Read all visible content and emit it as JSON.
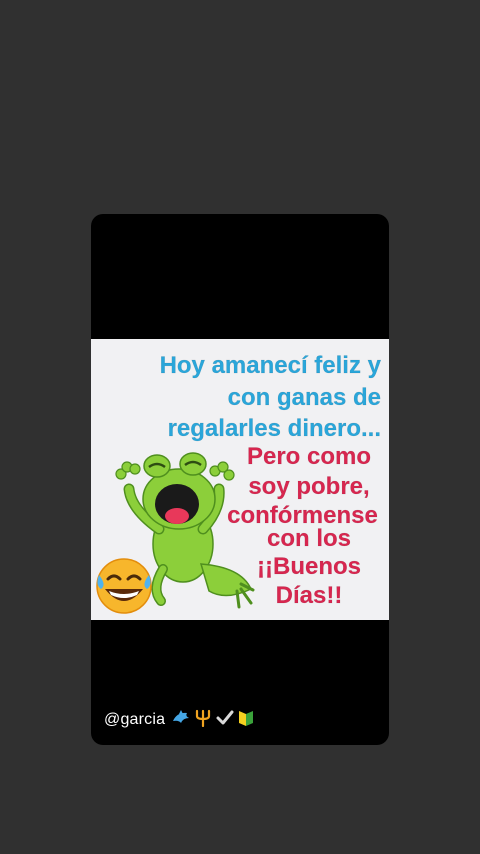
{
  "meme": {
    "line1": "Hoy amanecí feliz y",
    "line2": "con ganas de",
    "line3": "regalarles dinero...",
    "line4": "Pero como",
    "line5": "soy pobre,",
    "line6": "confórmense",
    "line7": "con los",
    "line8": "¡¡Buenos",
    "line9": "Días!!"
  },
  "caption": {
    "handle": "@garcia",
    "emoji_icons": [
      "dolphin-icon",
      "trident-icon",
      "check-mark-icon",
      "beginner-badge-icon"
    ]
  },
  "colors": {
    "background": "#303030",
    "card": "#000000",
    "blue_text": "#2aa6da",
    "red_text": "#d8264f",
    "frog_green": "#8ccf3a"
  }
}
